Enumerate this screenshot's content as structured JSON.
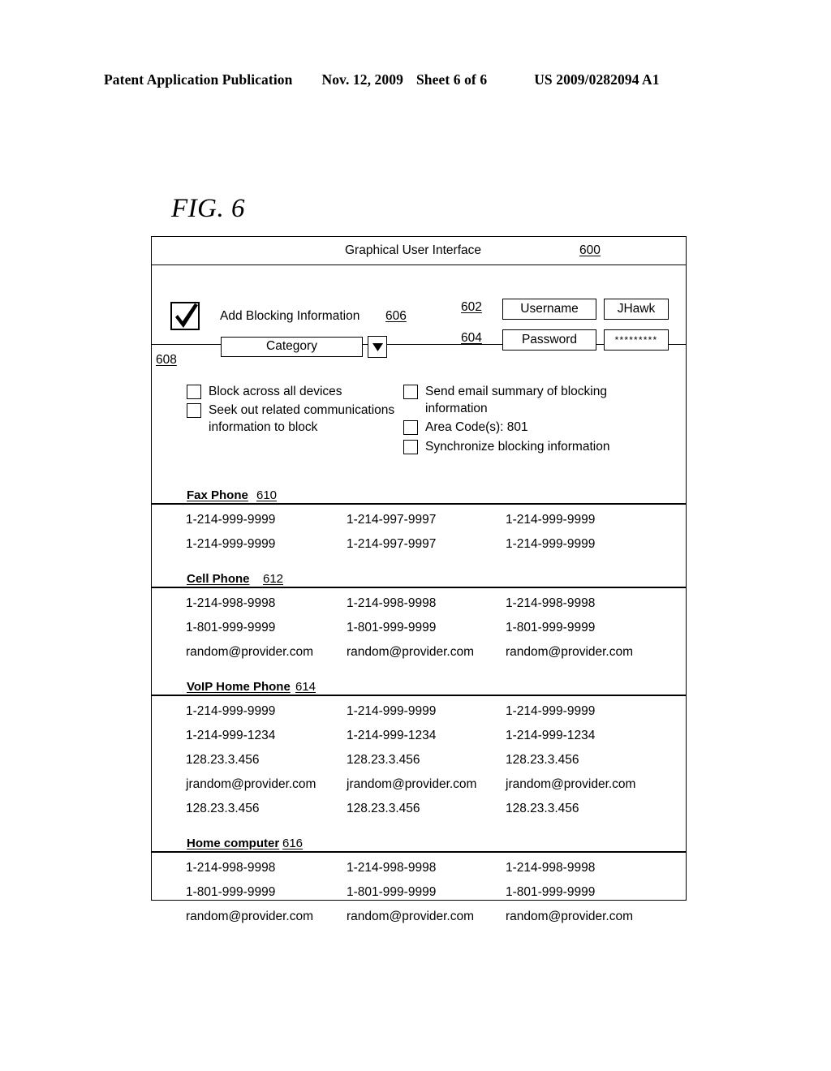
{
  "page_header": {
    "publication": "Patent Application Publication",
    "date": "Nov. 12, 2009",
    "sheet": "Sheet 6 of 6",
    "patent_number": "US 2009/0282094 A1"
  },
  "figure": {
    "label": "FIG. 6"
  },
  "gui": {
    "titlebar": {
      "title": "Graphical User Interface",
      "ref": "600"
    },
    "login": {
      "checkbox_icon": "checkmark-icon",
      "add_blocking_label": "Add Blocking Information",
      "add_blocking_ref": "606",
      "category_value": "Category",
      "category_arrow_icon": "chevron-down-icon",
      "username_ref": "602",
      "username_label": "Username",
      "username_value": "JHawk",
      "password_ref": "604",
      "password_label": "Password",
      "password_value": "*********"
    },
    "options": {
      "ref": "608",
      "left_column": [
        "Block across all devices",
        "Seek out related communications information to block"
      ],
      "right_column": [
        "Send email summary of blocking information",
        "Area Code(s): 801",
        "Synchronize blocking information"
      ]
    },
    "devices": [
      {
        "title": "Fax Phone",
        "ref": "610",
        "rows": [
          [
            "1-214-999-9999",
            "1-214-997-9997",
            "1-214-999-9999"
          ],
          [
            "1-214-999-9999",
            "1-214-997-9997",
            "1-214-999-9999"
          ]
        ]
      },
      {
        "title": "Cell Phone",
        "ref": "612",
        "rows": [
          [
            "1-214-998-9998",
            "1-214-998-9998",
            "1-214-998-9998"
          ],
          [
            "1-801-999-9999",
            "1-801-999-9999",
            "1-801-999-9999"
          ],
          [
            "random@provider.com",
            "random@provider.com",
            "random@provider.com"
          ]
        ]
      },
      {
        "title": "VoIP Home Phone",
        "ref": "614",
        "rows": [
          [
            "1-214-999-9999",
            "1-214-999-9999",
            "1-214-999-9999"
          ],
          [
            "1-214-999-1234",
            "1-214-999-1234",
            "1-214-999-1234"
          ],
          [
            "128.23.3.456",
            "128.23.3.456",
            "128.23.3.456"
          ],
          [
            "jrandom@provider.com",
            "jrandom@provider.com",
            "jrandom@provider.com"
          ],
          [
            "128.23.3.456",
            "128.23.3.456",
            "128.23.3.456"
          ]
        ]
      },
      {
        "title": "Home computer",
        "ref": "616",
        "rows": [
          [
            "1-214-998-9998",
            "1-214-998-9998",
            "1-214-998-9998"
          ],
          [
            "1-801-999-9999",
            "1-801-999-9999",
            "1-801-999-9999"
          ],
          [
            "random@provider.com",
            "random@provider.com",
            "random@provider.com"
          ]
        ]
      }
    ]
  }
}
